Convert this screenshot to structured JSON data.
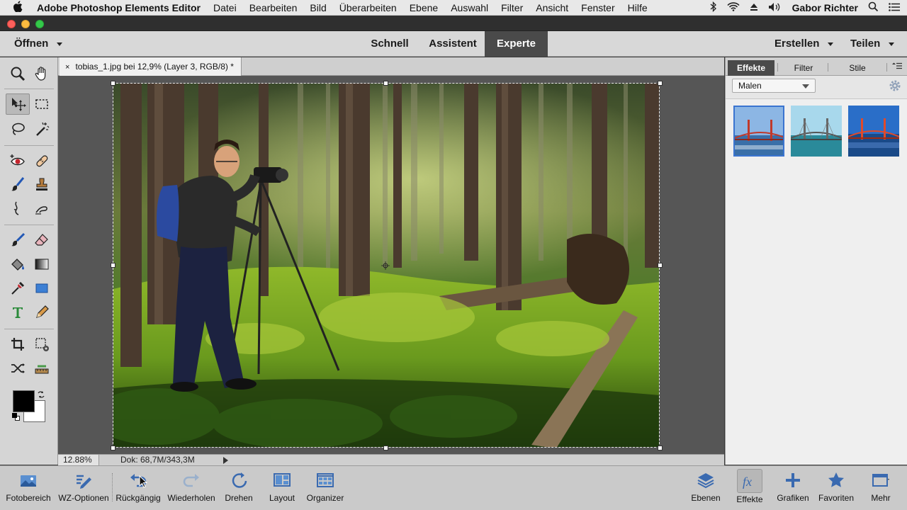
{
  "menubar": {
    "apple": "",
    "app_name": "Adobe Photoshop Elements Editor",
    "items": [
      "Datei",
      "Bearbeiten",
      "Bild",
      "Überarbeiten",
      "Ebene",
      "Auswahl",
      "Filter",
      "Ansicht",
      "Fenster",
      "Hilfe"
    ],
    "user": "Gabor Richter",
    "status_icons": [
      "bluetooth-icon",
      "wifi-icon",
      "eject-icon",
      "volume-icon"
    ]
  },
  "modebar": {
    "open_label": "Öffnen",
    "modes": [
      "Schnell",
      "Assistent",
      "Experte"
    ],
    "active_mode": "Experte",
    "create_label": "Erstellen",
    "share_label": "Teilen"
  },
  "document": {
    "tab_close": "×",
    "tab_title": "tobias_1.jpg bei 12,9% (Layer 3, RGB/8) *"
  },
  "status": {
    "zoom": "12.88%",
    "doc_size": "Dok: 68,7M/343,3M"
  },
  "panel": {
    "tabs": [
      "Effekte",
      "Filter",
      "Stile"
    ],
    "active_tab": "Effekte",
    "category": "Malen",
    "thumbnails": [
      "effect-thumb-1",
      "effect-thumb-2",
      "effect-thumb-3"
    ]
  },
  "bottombar": {
    "left": [
      {
        "label": "Fotobereich",
        "icon": "photo-bin-icon"
      },
      {
        "label": "WZ-Optionen",
        "icon": "tool-options-icon"
      },
      {
        "label": "Rückgängig",
        "icon": "undo-icon"
      },
      {
        "label": "Wiederholen",
        "icon": "redo-icon"
      },
      {
        "label": "Drehen",
        "icon": "rotate-icon"
      },
      {
        "label": "Layout",
        "icon": "layout-icon"
      },
      {
        "label": "Organizer",
        "icon": "organizer-icon"
      }
    ],
    "right": [
      {
        "label": "Ebenen",
        "icon": "layers-icon"
      },
      {
        "label": "Effekte",
        "icon": "fx-icon"
      },
      {
        "label": "Grafiken",
        "icon": "plus-icon"
      },
      {
        "label": "Favoriten",
        "icon": "star-icon"
      },
      {
        "label": "Mehr",
        "icon": "more-icon"
      }
    ]
  },
  "colors": {
    "accent": "#3a74d0",
    "active_tab": "#4a4a4a",
    "close": "#fc605c",
    "minimize": "#fdbc40",
    "zoom": "#34c84a"
  }
}
